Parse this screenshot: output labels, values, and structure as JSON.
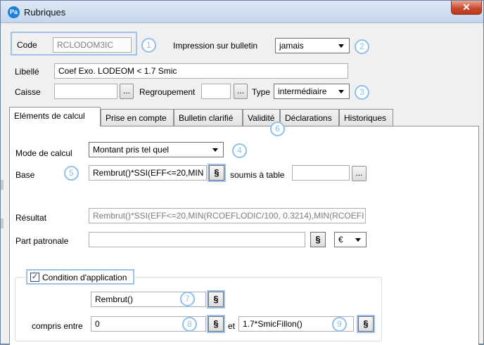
{
  "window": {
    "title": "Rubriques",
    "app_icon": "Pa",
    "close": "✕"
  },
  "header": {
    "code_label": "Code",
    "code_value": "RCLODOM3IC",
    "impression_label": "Impression sur bulletin",
    "impression_value": "jamais",
    "libelle_label": "Libellé",
    "libelle_value": "Coef Exo. LODEOM < 1.7 Smic",
    "caisse_label": "Caisse",
    "caisse_value": "",
    "regroupement_label": "Regroupement",
    "regroupement_value": "",
    "type_label": "Type",
    "type_value": "intermédiaire",
    "browse_label": "..."
  },
  "tabs": [
    {
      "label": "Eléments de calcul"
    },
    {
      "label": "Prise en compte"
    },
    {
      "label": "Bulletin clarifié"
    },
    {
      "label": "Validité"
    },
    {
      "label": "Déclarations"
    },
    {
      "label": "Historiques"
    }
  ],
  "calc": {
    "mode_label": "Mode de calcul",
    "mode_value": "Montant pris tel quel",
    "base_label": "Base",
    "base_value": "Rembrut()*SSI(EFF<=20,MIN",
    "soumis_label": "soumis à table",
    "soumis_value": "",
    "resultat_label": "Résultat",
    "resultat_value": "Rembrut()*SSI(EFF<=20,MIN(RCOEFLODIC/100, 0.3214),MIN(RCOEFI",
    "part_label": "Part patronale",
    "part_value": "",
    "currency_value": "€",
    "section_symbol": "§"
  },
  "condition": {
    "label": "Condition d'application",
    "checked": "✓",
    "expr_value": "Rembrut()",
    "compris_label": "compris entre",
    "min_value": "0",
    "et_label": "et",
    "max_value": "1.7*SmicFillon()"
  },
  "badges": [
    "1",
    "2",
    "3",
    "4",
    "5",
    "6",
    "7",
    "8",
    "9"
  ],
  "colors": {
    "accent": "#8ec0ec",
    "highlight": "#9dc3ea",
    "close": "#c8452a"
  }
}
